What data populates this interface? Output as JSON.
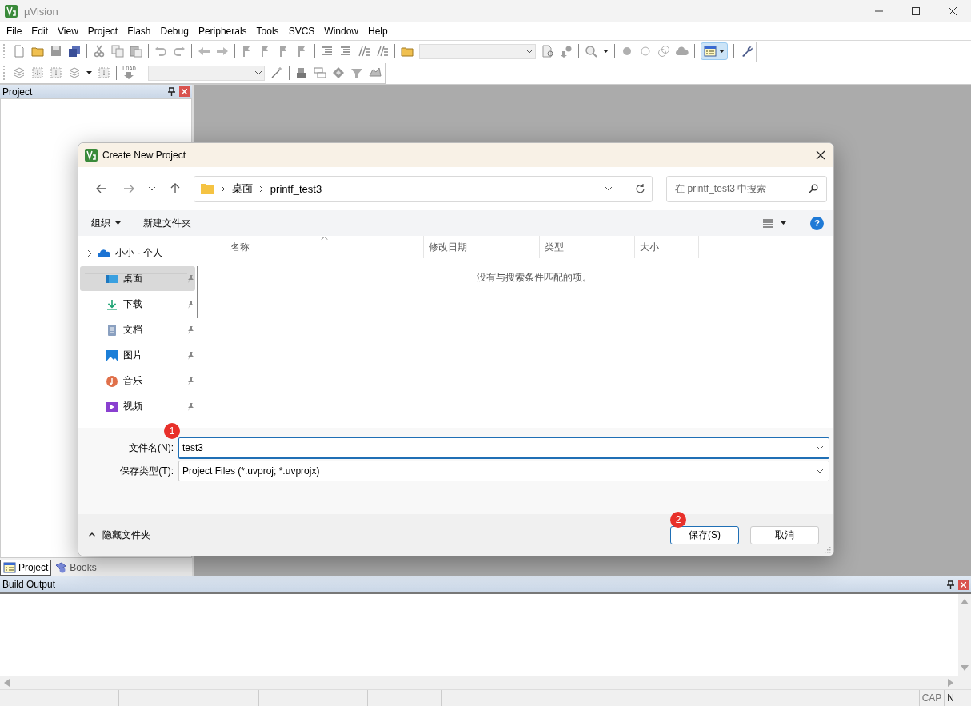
{
  "window": {
    "title": "µVision"
  },
  "menu": [
    "File",
    "Edit",
    "View",
    "Project",
    "Flash",
    "Debug",
    "Peripherals",
    "Tools",
    "SVCS",
    "Window",
    "Help"
  ],
  "toolbars": {
    "view_button": {
      "on": true
    },
    "load_label": "LOAD"
  },
  "project_panel": {
    "title": "Project",
    "tabs": [
      {
        "label": "Project",
        "selected": true
      },
      {
        "label": "Books",
        "selected": false
      }
    ]
  },
  "dialog": {
    "title": "Create New Project",
    "breadcrumb": [
      "桌面",
      "printf_test3"
    ],
    "search": {
      "placeholder": "在 printf_test3 中搜索"
    },
    "organize": "组织",
    "new_folder": "新建文件夹",
    "help": "?",
    "nav_items": [
      {
        "label": "小小 - 个人",
        "kind": "cloud",
        "selected": false,
        "pinned": false
      },
      {
        "label": "桌面",
        "kind": "desktop",
        "selected": true,
        "pinned": true
      },
      {
        "label": "下载",
        "kind": "download",
        "selected": false,
        "pinned": true
      },
      {
        "label": "文档",
        "kind": "documents",
        "selected": false,
        "pinned": true
      },
      {
        "label": "图片",
        "kind": "pictures",
        "selected": false,
        "pinned": true
      },
      {
        "label": "音乐",
        "kind": "music",
        "selected": false,
        "pinned": true
      },
      {
        "label": "视频",
        "kind": "videos",
        "selected": false,
        "pinned": true
      }
    ],
    "columns": [
      {
        "label": "名称",
        "sorted": true
      },
      {
        "label": "修改日期",
        "sorted": false
      },
      {
        "label": "类型",
        "sorted": false
      },
      {
        "label": "大小",
        "sorted": false
      }
    ],
    "empty_message": "没有与搜索条件匹配的项。",
    "file_name": {
      "label": "文件名(N):",
      "value": "test3",
      "focused": true,
      "badge": "1"
    },
    "file_type": {
      "label": "保存类型(T):",
      "value": "Project Files (*.uvproj; *.uvprojx)",
      "focused": false
    },
    "hide_folders": "隐藏文件夹",
    "buttons": [
      {
        "label": "保存(S)",
        "default": true,
        "badge": "2"
      },
      {
        "label": "取消",
        "default": false
      }
    ]
  },
  "build_output": {
    "title": "Build Output"
  },
  "status_bar": [
    "CAP",
    "N"
  ]
}
